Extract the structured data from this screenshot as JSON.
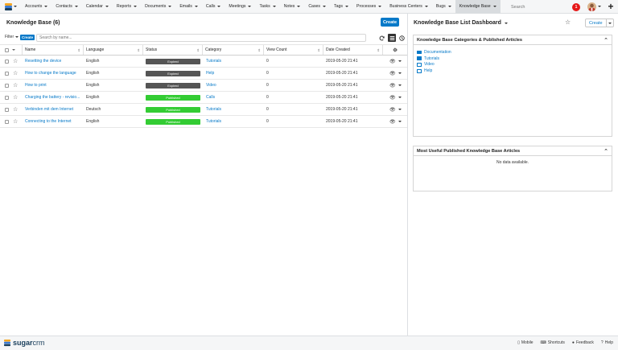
{
  "nav": {
    "items": [
      {
        "label": "Accounts"
      },
      {
        "label": "Contacts"
      },
      {
        "label": "Calendar"
      },
      {
        "label": "Reports"
      },
      {
        "label": "Documents"
      },
      {
        "label": "Emails"
      },
      {
        "label": "Calls"
      },
      {
        "label": "Meetings"
      },
      {
        "label": "Tasks"
      },
      {
        "label": "Notes"
      },
      {
        "label": "Cases"
      },
      {
        "label": "Tags"
      },
      {
        "label": "Processes"
      },
      {
        "label": "Business Centers"
      },
      {
        "label": "Bugs"
      },
      {
        "label": "Knowledge Base"
      }
    ],
    "search_placeholder": "Search",
    "notification_count": "1"
  },
  "list": {
    "title": "Knowledge Base (6)",
    "create_label": "Create",
    "filter_label": "Filter",
    "filter_create": "Create",
    "search_placeholder": "Search by name...",
    "columns": [
      "Name",
      "Language",
      "Status",
      "Category",
      "View Count",
      "Date Created"
    ],
    "rows": [
      {
        "name": "Resetting the device",
        "language": "English",
        "status": "Expired",
        "category": "Tutorials",
        "views": "0",
        "date": "2019-05-20 21:41"
      },
      {
        "name": "How to change the language",
        "language": "English",
        "status": "Expired",
        "category": "Help",
        "views": "0",
        "date": "2019-05-20 21:41"
      },
      {
        "name": "How to print",
        "language": "English",
        "status": "Expired",
        "category": "Video",
        "views": "0",
        "date": "2019-05-20 21:41"
      },
      {
        "name": "Charging the battery - revisio...",
        "language": "English",
        "status": "Published",
        "category": "Calls",
        "views": "0",
        "date": "2019-05-20 21:41"
      },
      {
        "name": "Verbinden mit dem Internet",
        "language": "Deutsch",
        "status": "Published",
        "category": "Tutorials",
        "views": "0",
        "date": "2019-05-20 21:41"
      },
      {
        "name": "Connecting to the Internet",
        "language": "English",
        "status": "Published",
        "category": "Tutorials",
        "views": "0",
        "date": "2019-05-20 21:41"
      }
    ]
  },
  "dashboard": {
    "title": "Knowledge Base List Dashboard",
    "create_label": "Create",
    "dashlet1": {
      "title": "Knowledge Base Categories & Published Articles",
      "items": [
        {
          "label": "Documentation",
          "filled": true
        },
        {
          "label": "Tutorials",
          "filled": true
        },
        {
          "label": "Video",
          "filled": false
        },
        {
          "label": "Help",
          "filled": false
        }
      ]
    },
    "dashlet2": {
      "title": "Most Useful Published Knowledge Base Articles",
      "empty_text": "No data available."
    }
  },
  "footer": {
    "brand_sugar": "sugar",
    "brand_crm": "crm",
    "links": [
      "Mobile",
      "Shortcuts",
      "Feedback",
      "Help"
    ]
  },
  "colors": {
    "accent": "#0679c8",
    "published": "#33cc33",
    "expired": "#555555",
    "notification": "#e61718"
  }
}
